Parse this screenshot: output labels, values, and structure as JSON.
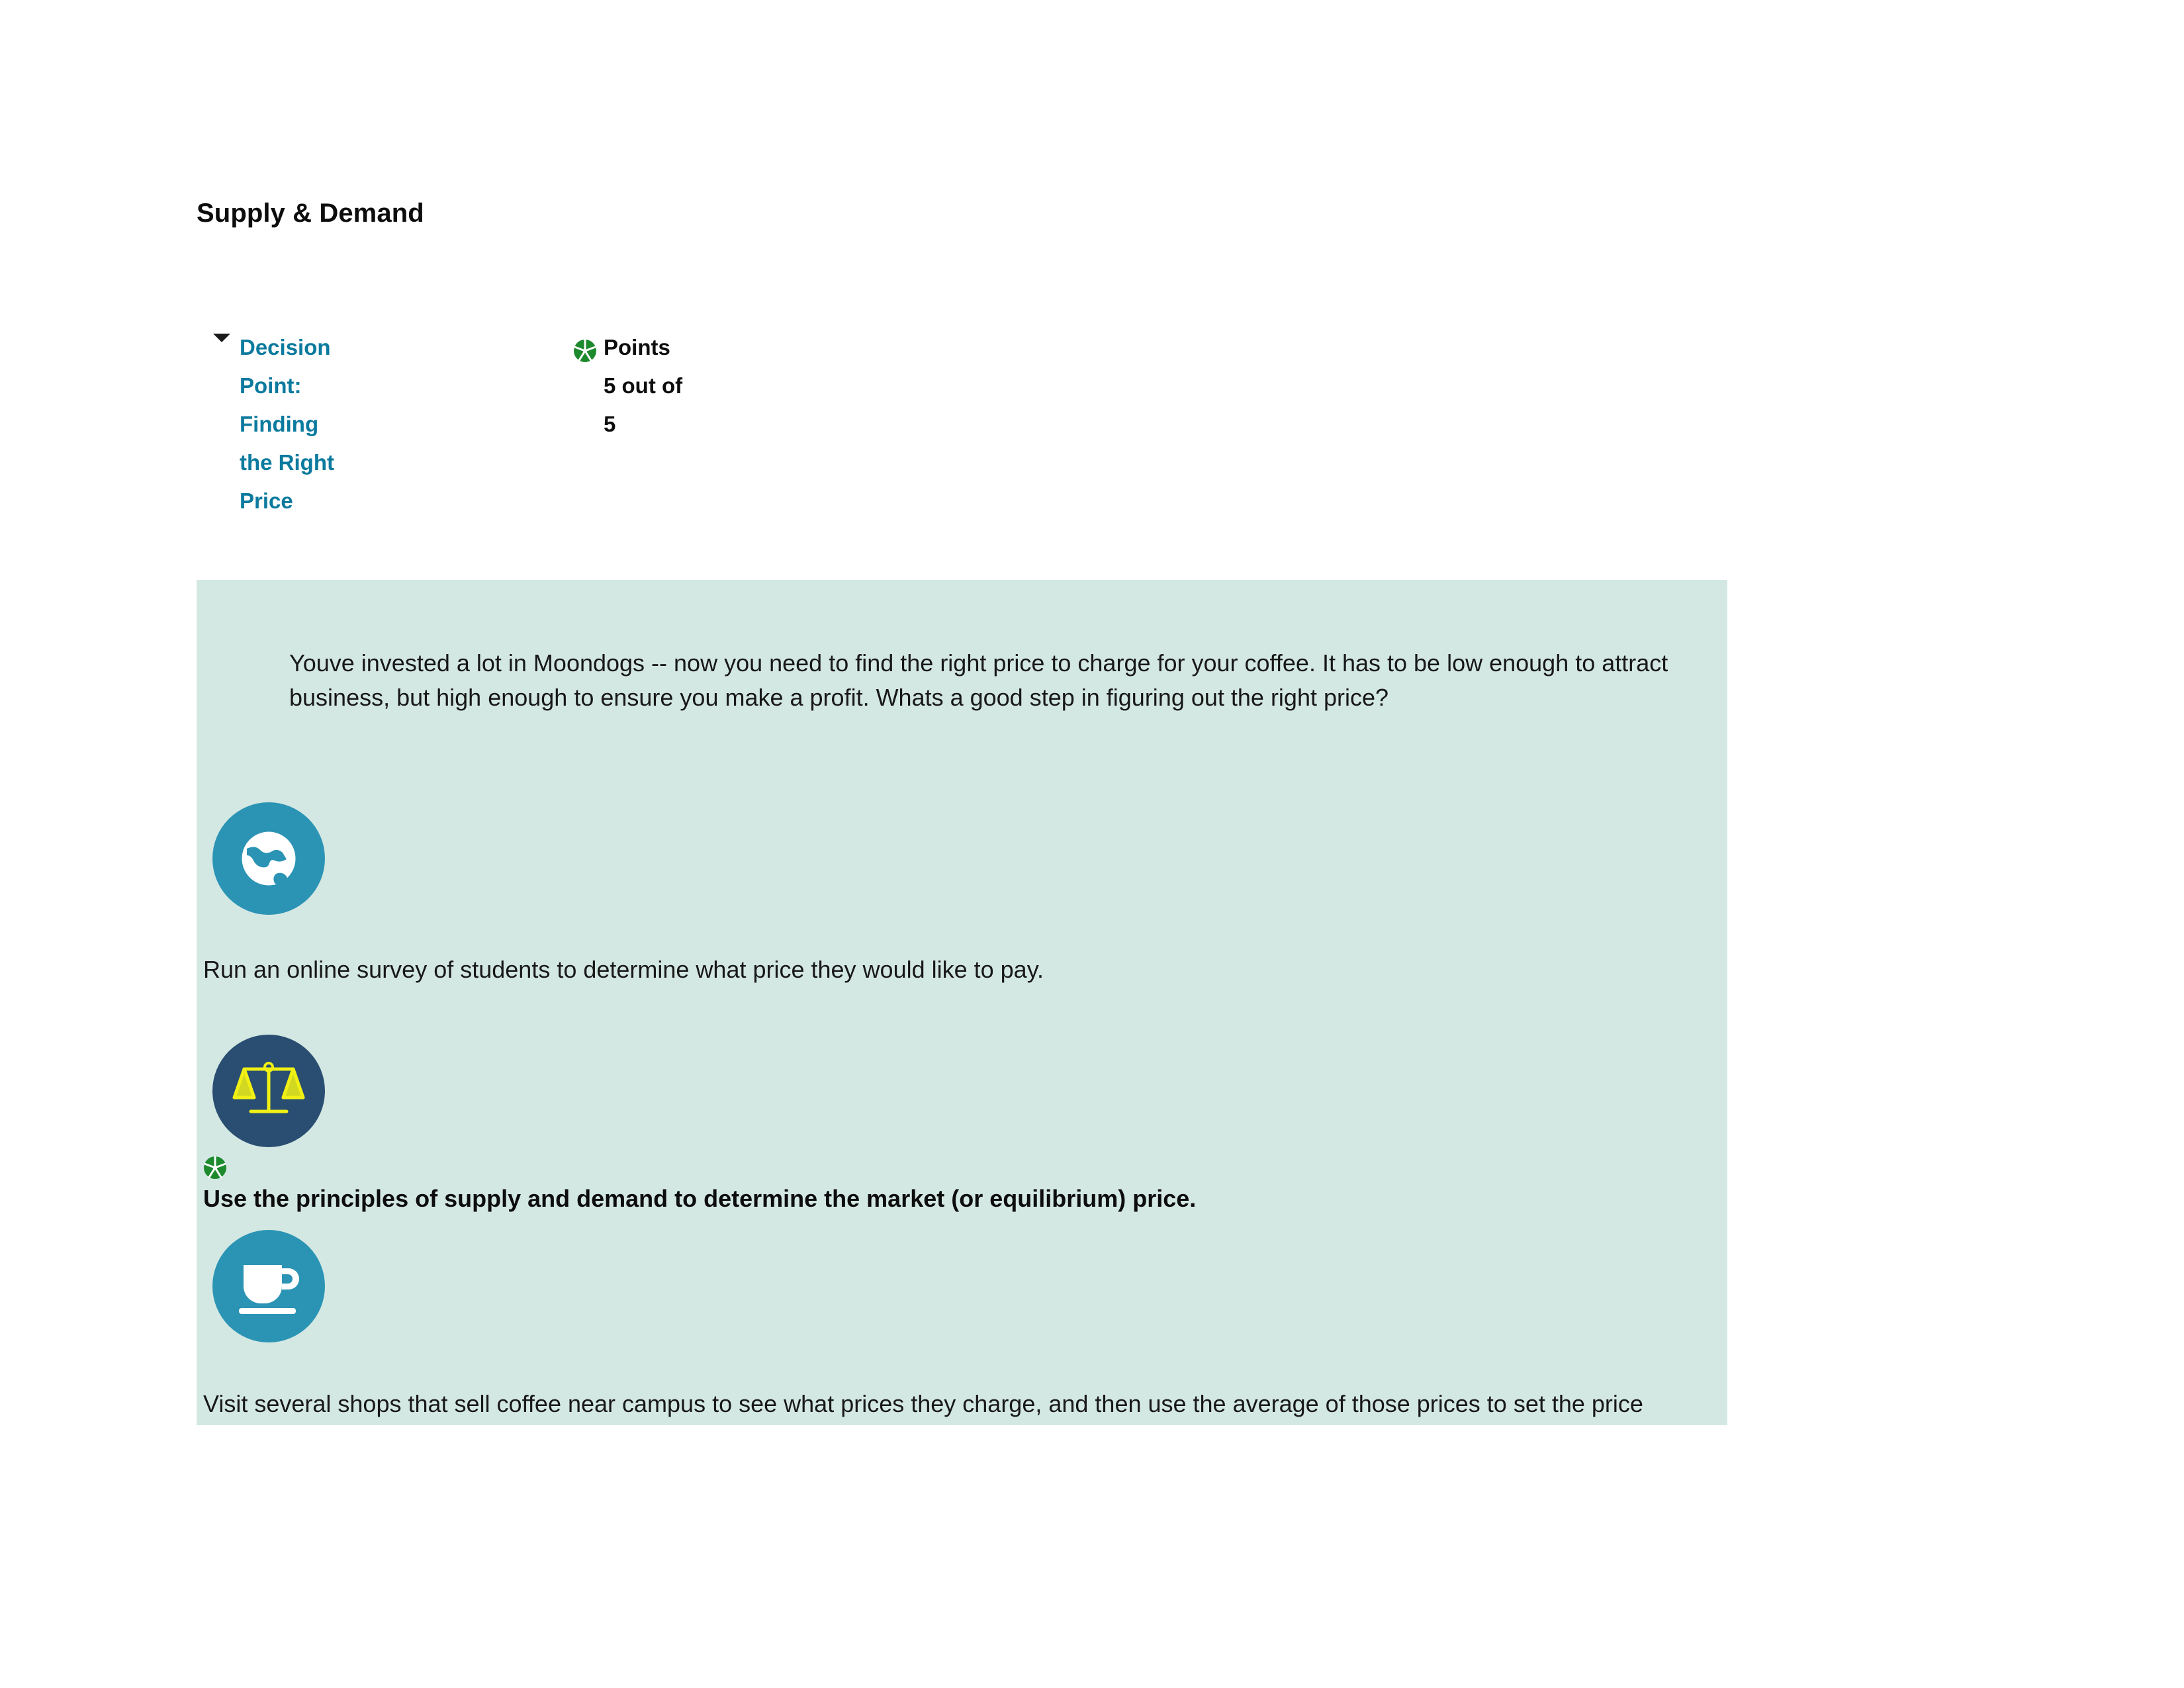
{
  "page": {
    "title": "Supply & Demand"
  },
  "quiz": {
    "collapse_icon": "triangle-down-icon",
    "decision_point_title": "Decision Point: Finding the Right Price",
    "points_icon": "green-pinwheel-icon",
    "points_label": "Points",
    "points_value": "5 out of 5"
  },
  "question": {
    "prompt": "Youve invested a lot in Moondogs -- now you need to find the right price to charge for your coffee. It has to be low enough to attract business, but high enough to ensure you make a profit. Whats a good step in figuring out the right price?",
    "options": [
      {
        "icon": "globe-icon",
        "icon_circle_color": "#2b94b5",
        "text": "Run an online survey of students to determine what price they would like to pay.",
        "correct": false,
        "badge": null
      },
      {
        "icon": "balance-scales-icon",
        "icon_circle_color": "#2a4e72",
        "text": "Use the principles of supply and demand to determine the market (or equilibrium) price.",
        "correct": true,
        "badge": "green-pinwheel-icon"
      },
      {
        "icon": "coffee-cup-icon",
        "icon_circle_color": "#2b94b5",
        "text": "Visit several shops that sell coffee near campus to see what prices they charge, and then use the average of those prices to set the price",
        "correct": false,
        "badge": null
      }
    ]
  },
  "colors": {
    "panel_background": "#d4e8e3",
    "link": "#0b7a9e",
    "accent_teal": "#2b94b5",
    "accent_navy": "#2a4e72",
    "correct_green": "#1e8a2e",
    "scales_yellow": "#f0f014"
  }
}
